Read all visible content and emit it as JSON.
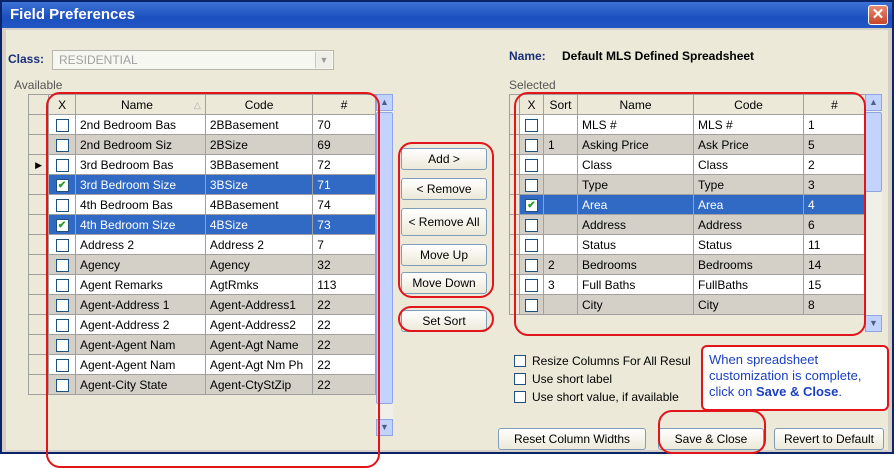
{
  "window": {
    "title": "Field Preferences",
    "close_glyph": "✕"
  },
  "class_field": {
    "label": "Class:",
    "value": "RESIDENTIAL"
  },
  "name_field": {
    "label": "Name:",
    "value": "Default MLS Defined Spreadsheet"
  },
  "available": {
    "label": "Available",
    "columns": {
      "check": "X",
      "name": "Name",
      "code": "Code",
      "num": "#"
    },
    "rows": [
      {
        "checked": false,
        "name": "2nd Bedroom Bas",
        "code": "2BBasement",
        "num": "70"
      },
      {
        "checked": false,
        "name": "2nd Bedroom Siz",
        "code": "2BSize",
        "num": "69"
      },
      {
        "checked": false,
        "name": "3rd Bedroom Bas",
        "code": "3BBasement",
        "num": "72"
      },
      {
        "checked": true,
        "name": "3rd Bedroom Size",
        "code": "3BSize",
        "num": "71"
      },
      {
        "checked": false,
        "name": "4th Bedroom Bas",
        "code": "4BBasement",
        "num": "74"
      },
      {
        "checked": true,
        "name": "4th Bedroom Size",
        "code": "4BSize",
        "num": "73"
      },
      {
        "checked": false,
        "name": "Address 2",
        "code": "Address 2",
        "num": "7"
      },
      {
        "checked": false,
        "name": "Agency",
        "code": "Agency",
        "num": "32"
      },
      {
        "checked": false,
        "name": "Agent Remarks",
        "code": "AgtRmks",
        "num": "113"
      },
      {
        "checked": false,
        "name": "Agent-Address 1",
        "code": "Agent-Address1",
        "num": "22"
      },
      {
        "checked": false,
        "name": "Agent-Address 2",
        "code": "Agent-Address2",
        "num": "22"
      },
      {
        "checked": false,
        "name": "Agent-Agent Nam",
        "code": "Agent-Agt Name",
        "num": "22"
      },
      {
        "checked": false,
        "name": "Agent-Agent Nam",
        "code": "Agent-Agt Nm Ph",
        "num": "22"
      },
      {
        "checked": false,
        "name": "Agent-City State",
        "code": "Agent-CtyStZip",
        "num": "22"
      }
    ]
  },
  "selected": {
    "label": "Selected",
    "columns": {
      "check": "X",
      "sort": "Sort",
      "name": "Name",
      "code": "Code",
      "num": "#"
    },
    "rows": [
      {
        "checked": false,
        "sort": "",
        "name": "MLS #",
        "code": "MLS #",
        "num": "1"
      },
      {
        "checked": false,
        "sort": "1",
        "name": "Asking Price",
        "code": "Ask Price",
        "num": "5"
      },
      {
        "checked": false,
        "sort": "",
        "name": "Class",
        "code": "Class",
        "num": "2"
      },
      {
        "checked": false,
        "sort": "",
        "name": "Type",
        "code": "Type",
        "num": "3"
      },
      {
        "checked": true,
        "sort": "",
        "name": "Area",
        "code": "Area",
        "num": "4"
      },
      {
        "checked": false,
        "sort": "",
        "name": "Address",
        "code": "Address",
        "num": "6"
      },
      {
        "checked": false,
        "sort": "",
        "name": "Status",
        "code": "Status",
        "num": "11"
      },
      {
        "checked": false,
        "sort": "2",
        "name": "Bedrooms",
        "code": "Bedrooms",
        "num": "14"
      },
      {
        "checked": false,
        "sort": "3",
        "name": "Full Baths",
        "code": "FullBaths",
        "num": "15"
      },
      {
        "checked": false,
        "sort": "",
        "name": "City",
        "code": "City",
        "num": "8"
      }
    ]
  },
  "middle_buttons": {
    "add": "Add >",
    "remove": "< Remove",
    "remove_all": "< Remove All",
    "move_up": "Move Up",
    "move_down": "Move Down",
    "set_sort": "Set Sort"
  },
  "options": {
    "resize": "Resize Columns For All Resul",
    "short_label": "Use short label",
    "short_value": "Use short value, if available"
  },
  "callout": {
    "line1": "When spreadsheet",
    "line2": "customization is complete,",
    "line3a": "click on ",
    "line3b": "Save & Close",
    "line3c": "."
  },
  "bottom_buttons": {
    "reset": "Reset Column Widths",
    "save_close": "Save & Close",
    "revert": "Revert to Default"
  },
  "colors": {
    "selection": "#316ac5",
    "annotation": "#e2151b",
    "title_bar": "#1c4fbf"
  }
}
